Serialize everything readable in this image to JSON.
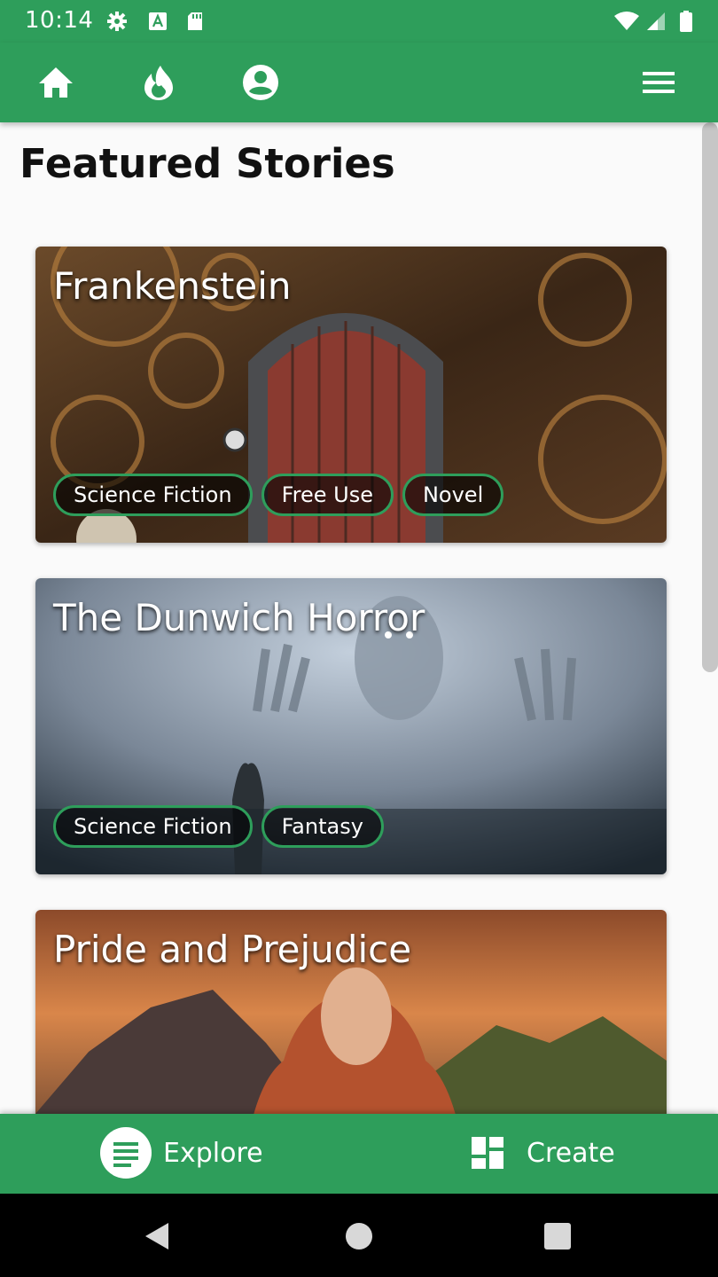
{
  "status_bar": {
    "time": "10:14",
    "left_icons": [
      "gear-icon",
      "a-box-icon",
      "sd-card-icon"
    ],
    "right_icons": [
      "wifi-icon",
      "signal-icon",
      "battery-icon"
    ]
  },
  "app_bar": {
    "nav_icons": [
      "home-icon",
      "flame-icon",
      "account-icon"
    ],
    "menu_icon": "hamburger-menu-icon",
    "color": "#2e9e5b"
  },
  "page": {
    "title": "Featured Stories"
  },
  "stories": [
    {
      "title": "Frankenstein",
      "tags": [
        "Science Fiction",
        "Free Use",
        "Novel"
      ]
    },
    {
      "title": "The Dunwich Horror",
      "tags": [
        "Science Fiction",
        "Fantasy"
      ]
    },
    {
      "title": "Pride and Prejudice",
      "tags": []
    }
  ],
  "bottom_nav": {
    "items": [
      {
        "label": "Explore",
        "icon": "explore-list-icon"
      },
      {
        "label": "Create",
        "icon": "dashboard-grid-icon"
      }
    ]
  },
  "system_nav": {
    "icons": [
      "back-icon",
      "home-circle-icon",
      "recents-icon"
    ]
  }
}
